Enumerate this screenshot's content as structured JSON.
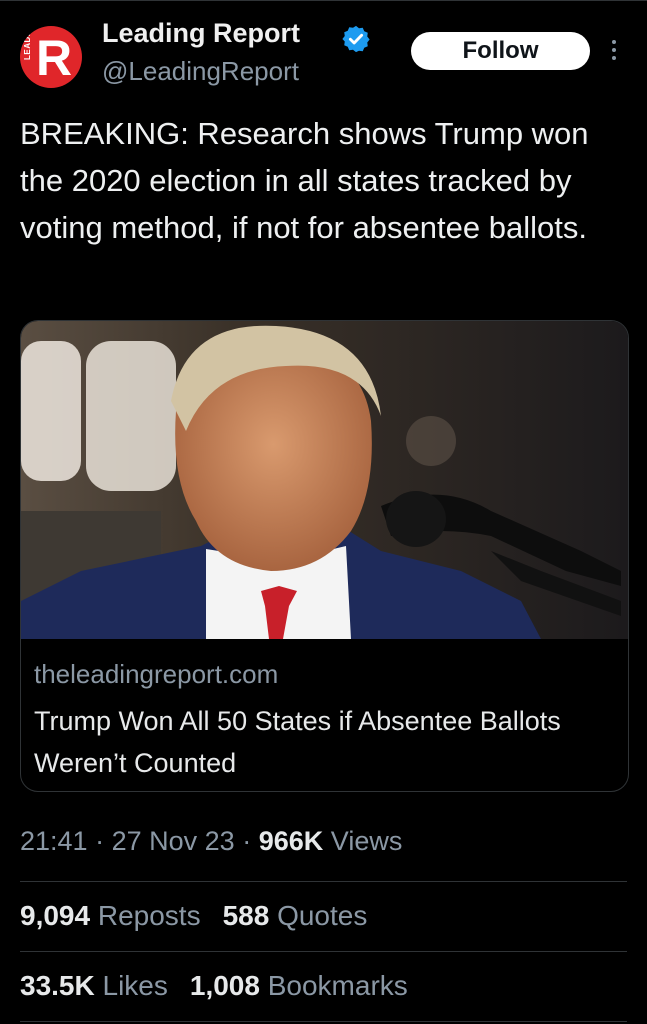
{
  "author": {
    "name": "Leading Report",
    "handle": "@LeadingReport",
    "avatar_letter": "R",
    "avatar_text": "LEADING",
    "verified_icon": "verified-badge-icon"
  },
  "header": {
    "follow_label": "Follow",
    "more_icon": "vertical-ellipsis-icon"
  },
  "tweet": {
    "text": "BREAKING: Research shows Trump won the 2020 election in all states tracked by voting method, if not for absentee ballots."
  },
  "card": {
    "image_description": "photo-trump-at-microphone",
    "domain": "theleadingreport.com",
    "title": "Trump Won All 50 States if Absentee Ballots Weren’t Counted"
  },
  "meta": {
    "time": "21:41",
    "date": "27 Nov 23",
    "sep": "·",
    "views_count": "966K",
    "views_label": "Views"
  },
  "stats": {
    "reposts_count": "9,094",
    "reposts_label": "Reposts",
    "quotes_count": "588",
    "quotes_label": "Quotes",
    "likes_count": "33.5K",
    "likes_label": "Likes",
    "bookmarks_count": "1,008",
    "bookmarks_label": "Bookmarks"
  },
  "colors": {
    "background": "#000000",
    "brand_red": "#e0262a",
    "verified_blue": "#1d9bf0",
    "muted": "#8b98a5"
  }
}
